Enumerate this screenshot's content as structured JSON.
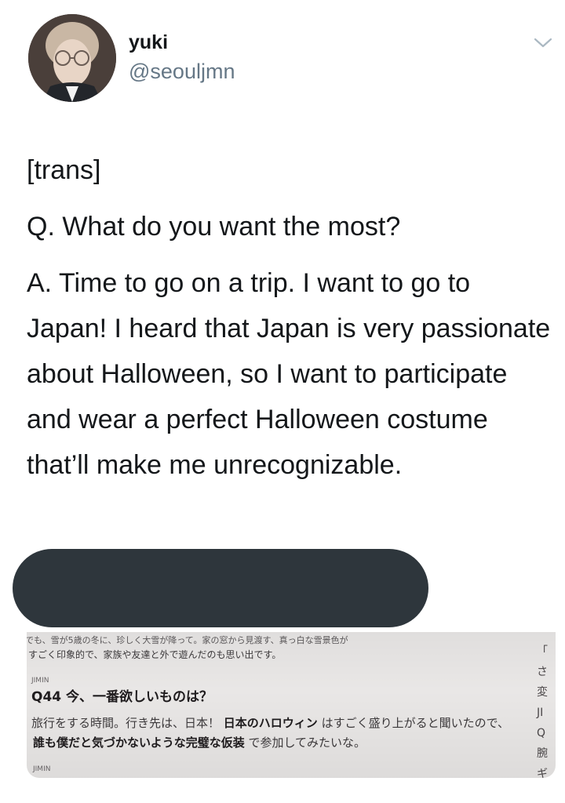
{
  "tweet": {
    "display_name": "yuki",
    "handle": "@seouljmn",
    "menu_icon": "chevron-down-icon",
    "paragraphs": [
      "[trans]",
      "Q. What do you want the most?",
      "A. Time to go on a trip. I want to go to Japan! I heard that Japan is very passionate about Halloween, so I want to participate and wear a perfect Halloween costume that’ll make me unrecognizable."
    ]
  },
  "media": {
    "lines": [
      "でも、雪が5歳の冬に、珍しく大雪が降って。家の窓から見渡す、真っ白な雪景色が",
      "すごく印象的で、家族や友達と外で遊んだのも思い出です。",
      "JIMIN",
      "Q44 今、一番欲しいものは？",
      "旅行をする時間。行き先は、日本！",
      "日本のハロウィン",
      "はすごく盛り上がると聞いたので、",
      "誰も僕だと気づかないような完璧な仮装",
      "で参加してみたいな。",
      "JIMIN"
    ],
    "right_column": [
      "「",
      "さ",
      "変",
      "JI",
      "Q",
      "腕",
      "ギ"
    ],
    "colors": {
      "background": "#e9e7e6",
      "redaction": "#2e363c"
    }
  }
}
